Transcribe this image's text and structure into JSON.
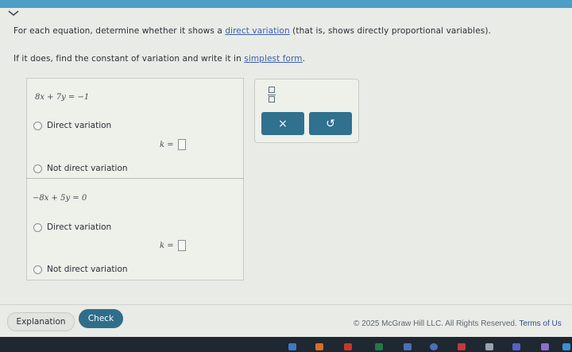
{
  "prompt": {
    "line1_pre": "For each equation, determine whether it shows a ",
    "line1_link": "direct variation",
    "line1_post": " (that is, shows directly proportional variables).",
    "line2_pre": "If it does, find the constant of variation and write it in ",
    "line2_link": "simplest form",
    "line2_post": "."
  },
  "problems": [
    {
      "equation": "8x + 7y = −1",
      "option_direct": "Direct variation",
      "k_label": "k =",
      "option_not_direct": "Not direct variation"
    },
    {
      "equation": "−8x + 5y = 0",
      "option_direct": "Direct variation",
      "k_label": "k =",
      "option_not_direct": "Not direct variation"
    }
  ],
  "toolbox": {
    "clear_label": "×",
    "undo_label": "↺"
  },
  "actions": {
    "explanation_label": "Explanation",
    "check_label": "Check"
  },
  "footer": {
    "copyright": "© 2025 McGraw Hill LLC. All Rights Reserved.",
    "terms": "Terms of Us"
  },
  "colors": {
    "accent": "#2f6e8a",
    "top_bar": "#4e9fc7"
  }
}
